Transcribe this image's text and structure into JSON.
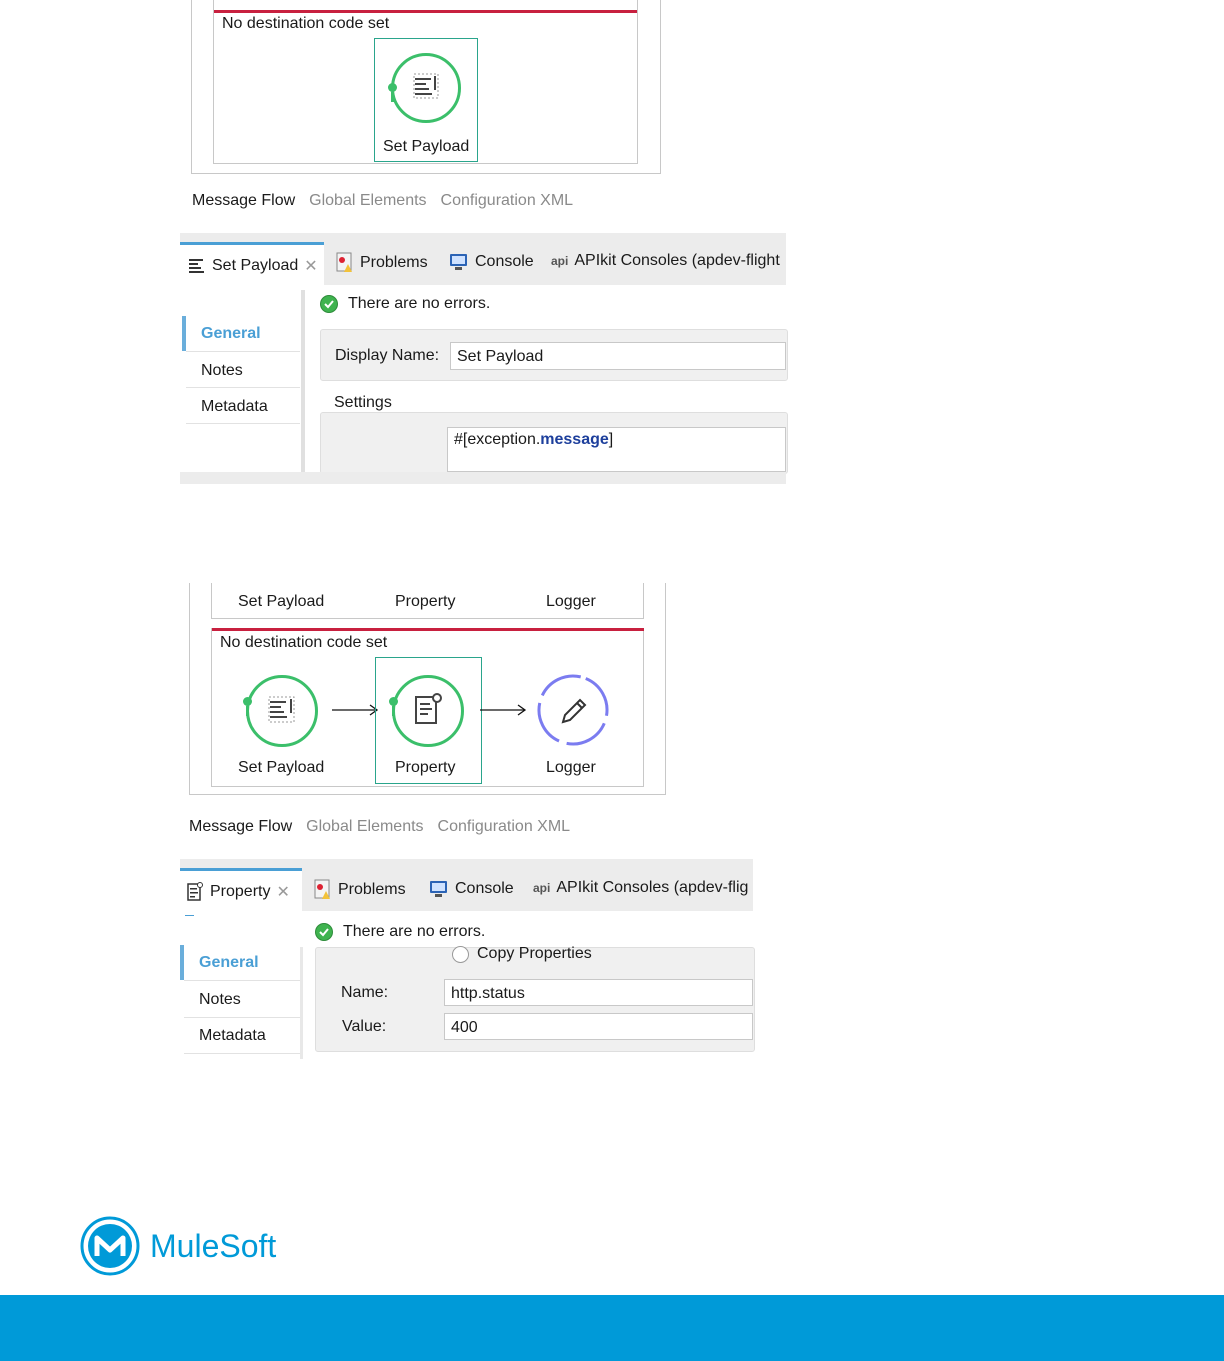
{
  "top": {
    "canvas": {
      "error_text": "No destination code set",
      "node_label": "Set Payload"
    },
    "bottom_tabs": [
      "Message Flow",
      "Global Elements",
      "Configuration XML"
    ],
    "panel_tabs": {
      "active": "Set Payload",
      "problems": "Problems",
      "console": "Console",
      "apikit_prefix": "api",
      "apikit": "APIkit Consoles (apdev-flight"
    },
    "status": "There are no errors.",
    "sidebar": [
      "General",
      "Notes",
      "Metadata"
    ],
    "display_name_label": "Display Name:",
    "display_name_value": "Set Payload",
    "settings_label": "Settings",
    "expression": {
      "prefix": "#[exception.",
      "keyword": "message",
      "suffix": "]"
    }
  },
  "bottom": {
    "prev_labels": [
      "Set Payload",
      "Property",
      "Logger"
    ],
    "canvas": {
      "error_text": "No destination code set",
      "nodes": [
        "Set Payload",
        "Property",
        "Logger"
      ]
    },
    "bottom_tabs": [
      "Message Flow",
      "Global Elements",
      "Configuration XML"
    ],
    "panel_tabs": {
      "active": "Property",
      "problems": "Problems",
      "console": "Console",
      "apikit_prefix": "api",
      "apikit": "APIkit Consoles (apdev-flig"
    },
    "status": "There are no errors.",
    "sidebar": [
      "General",
      "Notes",
      "Metadata"
    ],
    "copy_properties": "Copy Properties",
    "name_label": "Name:",
    "name_value": "http.status",
    "value_label": "Value:",
    "value_value": "400"
  },
  "brand": {
    "logo_text": "MuleSoft",
    "footer_color": "#009ad8",
    "accent_green": "#3bbf6a",
    "logger_purple": "#7b7cf0",
    "error_red": "#c8203f"
  }
}
